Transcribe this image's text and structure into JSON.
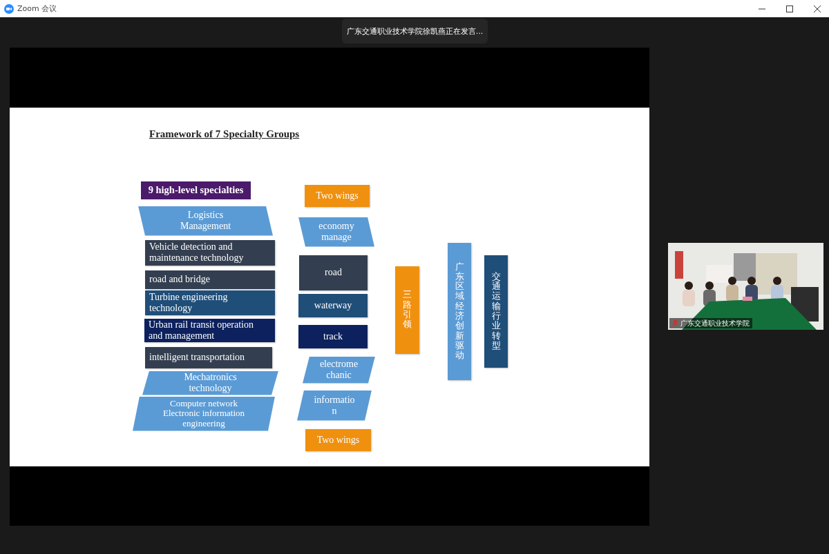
{
  "window": {
    "title": "Zoom 会议"
  },
  "speaker_banner": "广东交通职业技术学院徐凯燕正在发言...",
  "slide": {
    "title": "Framework of 7 Specialty Groups",
    "header": "9 high-level specialties",
    "specialties": [
      {
        "label": "Logistics\nManagement",
        "kind": "backslant",
        "color": "#5b9bd5"
      },
      {
        "label": "Vehicle detection and\nmaintenance technology",
        "kind": "box",
        "color": "#333f50"
      },
      {
        "label": "road and bridge",
        "kind": "box",
        "color": "#333f50"
      },
      {
        "label": "Turbine engineering\ntechnology",
        "kind": "box",
        "color": "#1f4e79"
      },
      {
        "label": "Urban rail transit operation\nand management",
        "kind": "box",
        "color": "#0c215e"
      },
      {
        "label": "intelligent transportation",
        "kind": "box",
        "color": "#333f50"
      },
      {
        "label": "Mechatronics\ntechnology",
        "kind": "slant",
        "color": "#5b9bd5"
      },
      {
        "label": "Computer network\nElectronic information\nengineering",
        "kind": "slant",
        "color": "#5b9bd5"
      }
    ],
    "groups": [
      {
        "label": "Two wings",
        "kind": "box",
        "color": "#f0900f"
      },
      {
        "label": "economy\nmanage",
        "kind": "backslant",
        "color": "#5b9bd5"
      },
      {
        "label": "road",
        "kind": "box",
        "color": "#333f50"
      },
      {
        "label": "waterway",
        "kind": "box",
        "color": "#1f4e79"
      },
      {
        "label": "track",
        "kind": "box",
        "color": "#0c215e"
      },
      {
        "label": "electrome\nchanic",
        "kind": "slant",
        "color": "#5b9bd5"
      },
      {
        "label": "informatio\nn",
        "kind": "slant",
        "color": "#5b9bd5"
      },
      {
        "label": "Two wings",
        "kind": "box",
        "color": "#f0900f"
      }
    ],
    "pillars": [
      {
        "label": "三路引领",
        "color": "#f0900f"
      },
      {
        "label": "广东区域经济创新驱动",
        "color": "#5b9bd5"
      },
      {
        "label": "交通运输行业转型",
        "color": "#1f4e79"
      }
    ]
  },
  "participant": {
    "name": "广东交通职业技术学院",
    "muted": true
  }
}
